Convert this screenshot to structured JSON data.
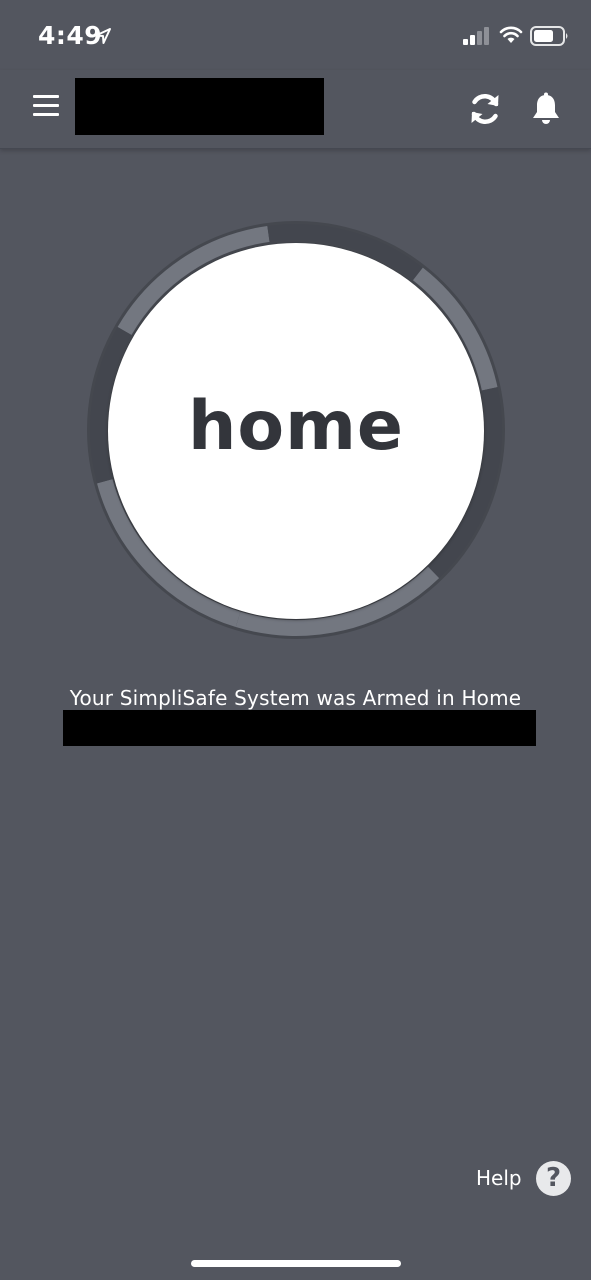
{
  "status_bar": {
    "time": "4:49",
    "icons": [
      "location-arrow-icon",
      "cellular-signal-icon",
      "wifi-icon",
      "battery-icon"
    ]
  },
  "header": {
    "menu_icon": "hamburger-menu-icon",
    "refresh_icon": "refresh-icon",
    "notifications_icon": "bell-icon"
  },
  "dial": {
    "mode_label": "home",
    "ring_colors": {
      "dark": "#43464e",
      "light": "#737780"
    }
  },
  "status": {
    "message": "Your SimpliSafe System was Armed in Home"
  },
  "help": {
    "label": "Help",
    "icon_glyph": "?"
  },
  "colors": {
    "background": "#53565f",
    "text": "#ffffff",
    "mode_text": "#33353b"
  }
}
